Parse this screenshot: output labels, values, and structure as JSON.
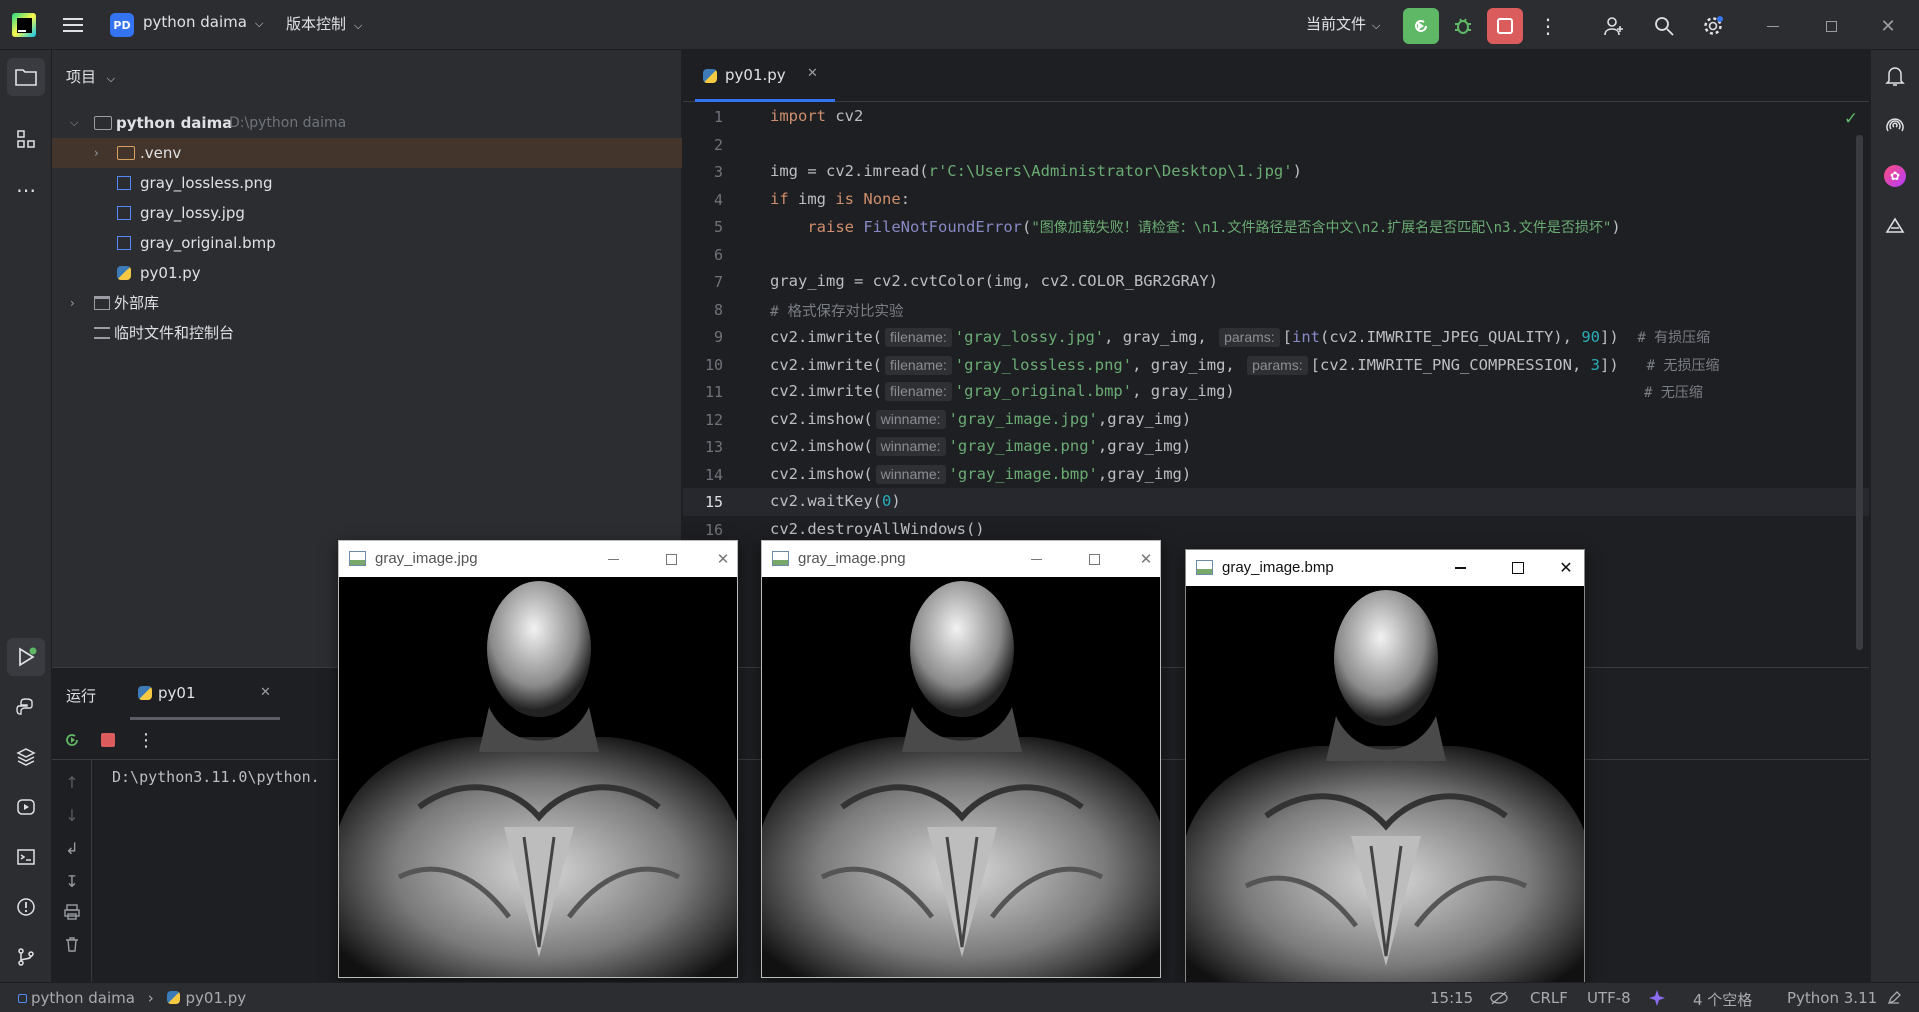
{
  "titlebar": {
    "project_badge": "PD",
    "project_name": "python daima",
    "vcs_label": "版本控制",
    "run_config": "当前文件"
  },
  "project_panel": {
    "header": "项目",
    "root_name": "python daima",
    "root_path": "D:\\python daima",
    "items": [
      {
        "label": ".venv"
      },
      {
        "label": "gray_lossless.png"
      },
      {
        "label": "gray_lossy.jpg"
      },
      {
        "label": "gray_original.bmp"
      },
      {
        "label": "py01.py"
      }
    ],
    "external_libs": "外部库",
    "scratches": "临时文件和控制台"
  },
  "editor": {
    "tab_label": "py01.py",
    "line_numbers": [
      "1",
      "2",
      "3",
      "4",
      "5",
      "6",
      "7",
      "8",
      "9",
      "10",
      "11",
      "12",
      "13",
      "14",
      "15",
      "16"
    ],
    "current_line": "15",
    "code": {
      "l1_kw": "import",
      "l1_rest": " cv2",
      "l3_pre": "img = cv2.imread(",
      "l3_str": "r'C:\\Users\\Administrator\\Desktop\\1.jpg'",
      "l3_post": ")",
      "l4_kw1": "if",
      "l4_mid": " img ",
      "l4_kw2": "is",
      "l4_sp": " ",
      "l4_kw3": "None",
      "l4_post": ":",
      "l5_ind": "    ",
      "l5_kw": "raise",
      "l5_sp": " ",
      "l5_exc": "FileNotFoundError",
      "l5_paren": "(",
      "l5_str": "\"图像加载失败！请检查：\\n1.文件路径是否含中文\\n2.扩展名是否匹配\\n3.文件是否损坏\"",
      "l5_post": ")",
      "l7": "gray_img = cv2.cvtColor(img, cv2.COLOR_BGR2GRAY)",
      "l8": "# 格式保存对比实验",
      "l9_pre": "cv2.imwrite(",
      "l9_hint1": "filename:",
      "l9_str": "'gray_lossy.jpg'",
      "l9_mid": ", gray_img, ",
      "l9_hint2": "params:",
      "l9_b1": "[",
      "l9_int": "int",
      "l9_b2": "(cv2.IMWRITE_JPEG_QUALITY), ",
      "l9_num": "90",
      "l9_b3": "])  ",
      "l9_cm": "# 有损压缩",
      "l10_pre": "cv2.imwrite(",
      "l10_hint1": "filename:",
      "l10_str": "'gray_lossless.png'",
      "l10_mid": ", gray_img, ",
      "l10_hint2": "params:",
      "l10_b1": "[cv2.IMWRITE_PNG_COMPRESSION, ",
      "l10_num": "3",
      "l10_b2": "])   ",
      "l10_cm": "# 无损压缩",
      "l11_pre": "cv2.imwrite(",
      "l11_hint": "filename:",
      "l11_str": "'gray_original.bmp'",
      "l11_post": ", gray_img)",
      "l11_cm": "# 无压缩",
      "l12_pre": "cv2.imshow(",
      "l12_hint": "winname:",
      "l12_str": "'gray_image.jpg'",
      "l12_post": ",gray_img)",
      "l13_pre": "cv2.imshow(",
      "l13_hint": "winname:",
      "l13_str": "'gray_image.png'",
      "l13_post": ",gray_img)",
      "l14_pre": "cv2.imshow(",
      "l14_hint": "winname:",
      "l14_str": "'gray_image.bmp'",
      "l14_post": ",gray_img)",
      "l15_pre": "cv2.waitKey(",
      "l15_num": "0",
      "l15_post": ")",
      "l16": "cv2.destroyAllWindows()"
    }
  },
  "run_panel": {
    "title": "运行",
    "tab_label": "py01",
    "console_line": "D:\\python3.11.0\\python."
  },
  "windows": [
    {
      "title": "gray_image.jpg"
    },
    {
      "title": "gray_image.png"
    },
    {
      "title": "gray_image.bmp"
    }
  ],
  "statusbar": {
    "crumb_project": "python daima",
    "crumb_file": "py01.py",
    "position": "15:15",
    "line_sep": "CRLF",
    "encoding": "UTF-8",
    "indent": "4 个空格",
    "interpreter": "Python 3.11"
  },
  "colors": {
    "accent_green": "#5fb865",
    "stop_red": "#db5c5c",
    "keyword": "#cf8e6d",
    "string": "#6aab73",
    "number": "#2aacb8"
  }
}
